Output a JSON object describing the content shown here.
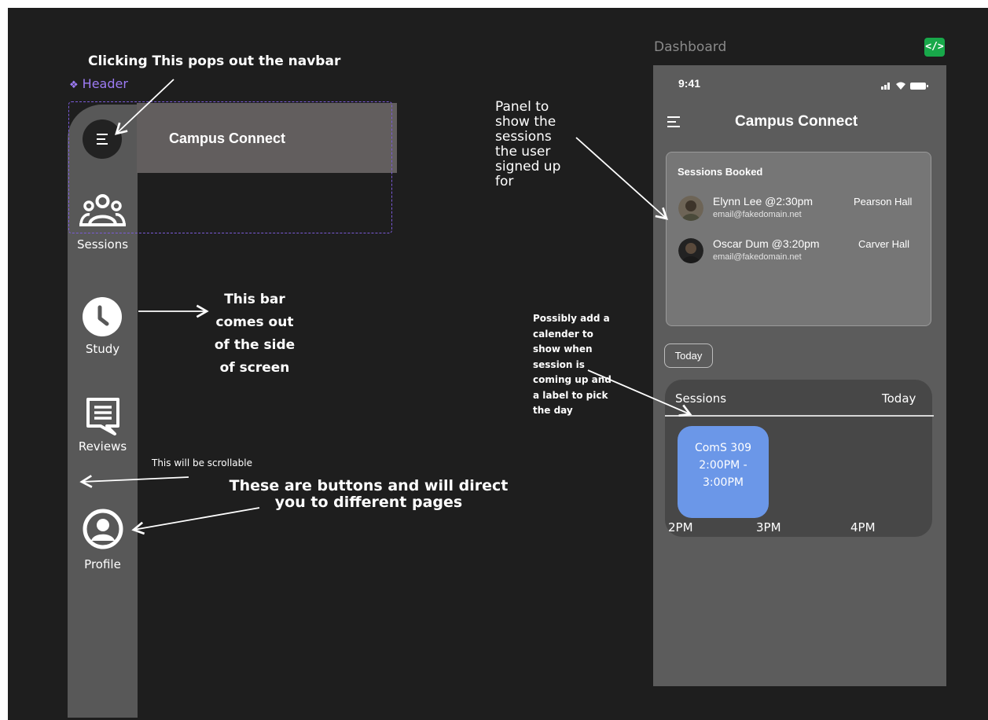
{
  "annotations": {
    "navbar_popout": "Clicking This pops out the navbar",
    "panel_note_lines": [
      "Panel to",
      "show the",
      "sessions",
      "the user",
      "signed up",
      "for"
    ],
    "sidebar_note_lines": [
      "This bar",
      "comes out",
      "of the side",
      "of screen"
    ],
    "calendar_note_lines": [
      "Possibly add a",
      "calender to",
      "show when",
      "session is",
      "coming up and",
      "a label to pick",
      "the day"
    ],
    "scrollable_note": "This will be scrollable",
    "buttons_note_lines": [
      "These are buttons and will direct",
      "you to different pages"
    ]
  },
  "left_frame": {
    "component_label": "Header",
    "header_title": "Campus Connect",
    "nav_items": [
      {
        "label": "Sessions",
        "icon": "users-group-icon"
      },
      {
        "label": "Study",
        "icon": "clock-icon"
      },
      {
        "label": "Reviews",
        "icon": "chat-icon"
      },
      {
        "label": "Profile",
        "icon": "user-circle-icon"
      }
    ]
  },
  "dashboard": {
    "frame_label": "Dashboard",
    "code_icon": "</>",
    "status_time": "9:41",
    "app_title": "Campus Connect",
    "sessions_booked_title": "Sessions Booked",
    "bookings": [
      {
        "name": "Elynn Lee @2:30pm",
        "email": "email@fakedomain.net",
        "location": "Pearson Hall"
      },
      {
        "name": "Oscar Dum @3:20pm",
        "email": "email@fakedomain.net",
        "location": "Carver Hall"
      }
    ],
    "today_button": "Today",
    "schedule": {
      "title": "Sessions",
      "day": "Today",
      "event_lines": [
        "ComS 309",
        "2:00PM -",
        "3:00PM"
      ],
      "times": [
        "2PM",
        "3PM",
        "4PM"
      ]
    }
  },
  "colors": {
    "background": "#1e1e1e",
    "sidebar": "#585858",
    "header_bar": "#625e5e",
    "component_label": "#9d7bf5",
    "event_block": "#6b97e8",
    "code_badge": "#18a84a"
  }
}
